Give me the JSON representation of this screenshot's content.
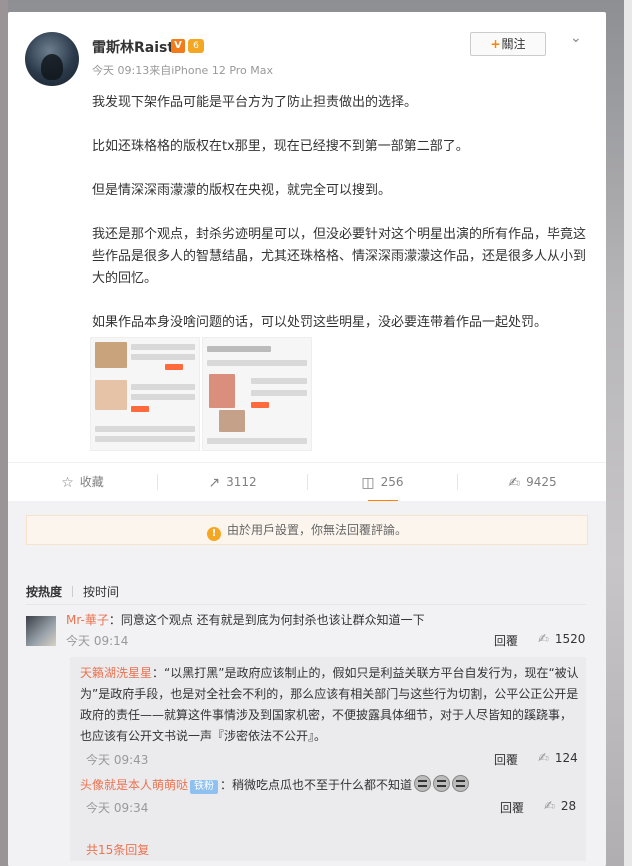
{
  "post": {
    "username": "雷斯林Raist",
    "v_badge": "V",
    "level_badge": "6",
    "meta": "今天 09:13来自iPhone 12 Pro Max",
    "follow_label": "關注",
    "paragraphs": [
      "我发现下架作品可能是平台方为了防止担责做出的选择。",
      "比如还珠格格的版权在tx那里，现在已经搜不到第一部第二部了。",
      "但是情深深雨濛濛的版权在央视，就完全可以搜到。",
      "我还是那个观点，封杀劣迹明星可以，但没必要针对这个明星出演的所有作品，毕竟这些作品是很多人的智慧结晶，尤其还珠格格、情深深雨濛濛这作品，还是很多人从小到大的回忆。",
      "如果作品本身没啥问题的话，可以处罚这些明星，没必要连带着作品一起处罚。"
    ]
  },
  "actions": {
    "favorite": "收藏",
    "repost": "3112",
    "comment": "256",
    "like": "9425"
  },
  "comments": {
    "notice": "由於用戶設置，你無法回覆評論。",
    "tab_hot": "按热度",
    "tab_time": "按时间",
    "main": {
      "name": "Mr-華子",
      "text": "：同意这个观点 还有就是到底为何封杀也该让群众知道一下",
      "time": "今天 09:14",
      "reply": "回覆",
      "likes": "1520"
    },
    "replies": [
      {
        "name": "天籟湖洗星星",
        "text": "：“以黑打黑”是政府应该制止的，假如只是利益关联方平台自发行为，现在“被认为”是政府手段，也是对全社会不利的，那么应该有相关部门与这些行为切割，公平公正公开是政府的责任——就算这件事情涉及到国家机密，不便披露具体细节，对于人尽皆知的蹊跷事，也应该有公开文书说一声『涉密依法不公开』。",
        "time": "今天 09:43",
        "reply": "回覆",
        "likes": "124"
      },
      {
        "name": "头像就是本人萌萌哒",
        "fan": "铁粉",
        "text": "：稍微吃点瓜也不至于什么都不知道",
        "time": "今天 09:34",
        "reply": "回覆",
        "likes": "28"
      }
    ],
    "more": "共15条回复"
  }
}
